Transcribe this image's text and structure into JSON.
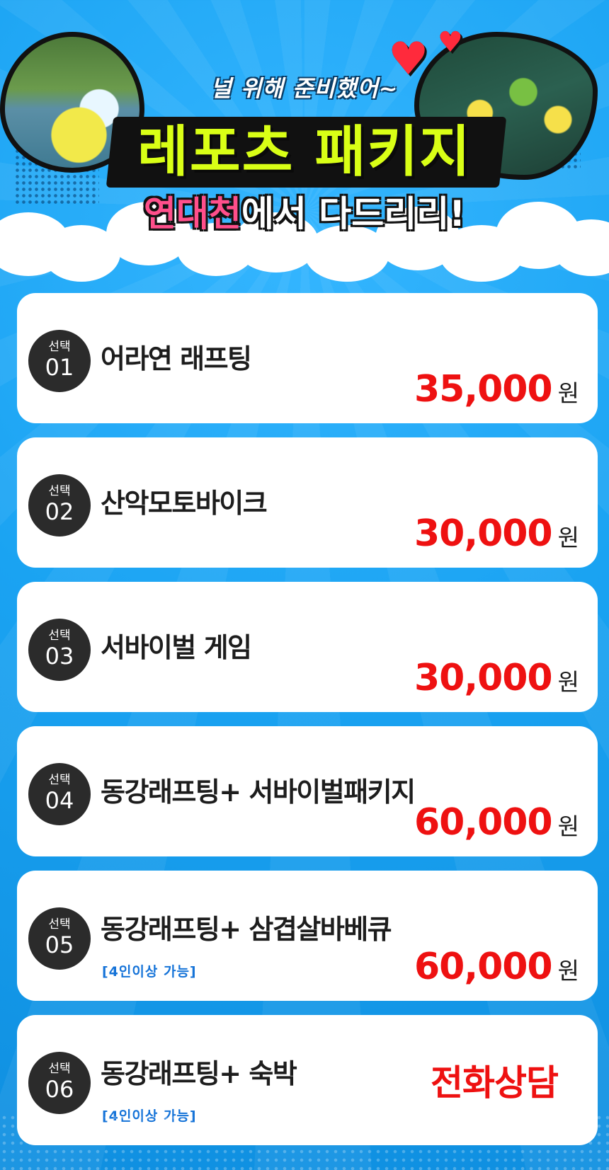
{
  "hero": {
    "tagline": "널 위해 준비했어~",
    "title": "레포츠 패키지",
    "subtitle_highlight": "연대천",
    "subtitle_rest": "에서 다드리리!"
  },
  "colors": {
    "background": "#1aa3f2",
    "title_lime": "#d9ff16",
    "highlight_pink": "#ff4f8b",
    "price_red": "#ee1111",
    "note_blue": "#1573d8",
    "badge_dark": "#2b2b2b"
  },
  "icons": [
    "heart-icon",
    "heart-icon"
  ],
  "items": [
    {
      "badge_label": "선택",
      "number": "01",
      "name": "어라연 래프팅",
      "note": "",
      "price": "35,000",
      "unit": "원"
    },
    {
      "badge_label": "선택",
      "number": "02",
      "name": "산악모토바이크",
      "note": "",
      "price": "30,000",
      "unit": "원"
    },
    {
      "badge_label": "선택",
      "number": "03",
      "name": "서바이벌 게임",
      "note": "",
      "price": "30,000",
      "unit": "원"
    },
    {
      "badge_label": "선택",
      "number": "04",
      "name": "동강래프팅+ 서바이벌패키지",
      "note": "",
      "price": "60,000",
      "unit": "원"
    },
    {
      "badge_label": "선택",
      "number": "05",
      "name": "동강래프팅+ 삼겹살바베큐",
      "note": "[4인이상 가능]",
      "price": "60,000",
      "unit": "원"
    },
    {
      "badge_label": "선택",
      "number": "06",
      "name": "동강래프팅+ 숙박",
      "note": "[4인이상 가능]",
      "consult": "전화상담"
    }
  ]
}
